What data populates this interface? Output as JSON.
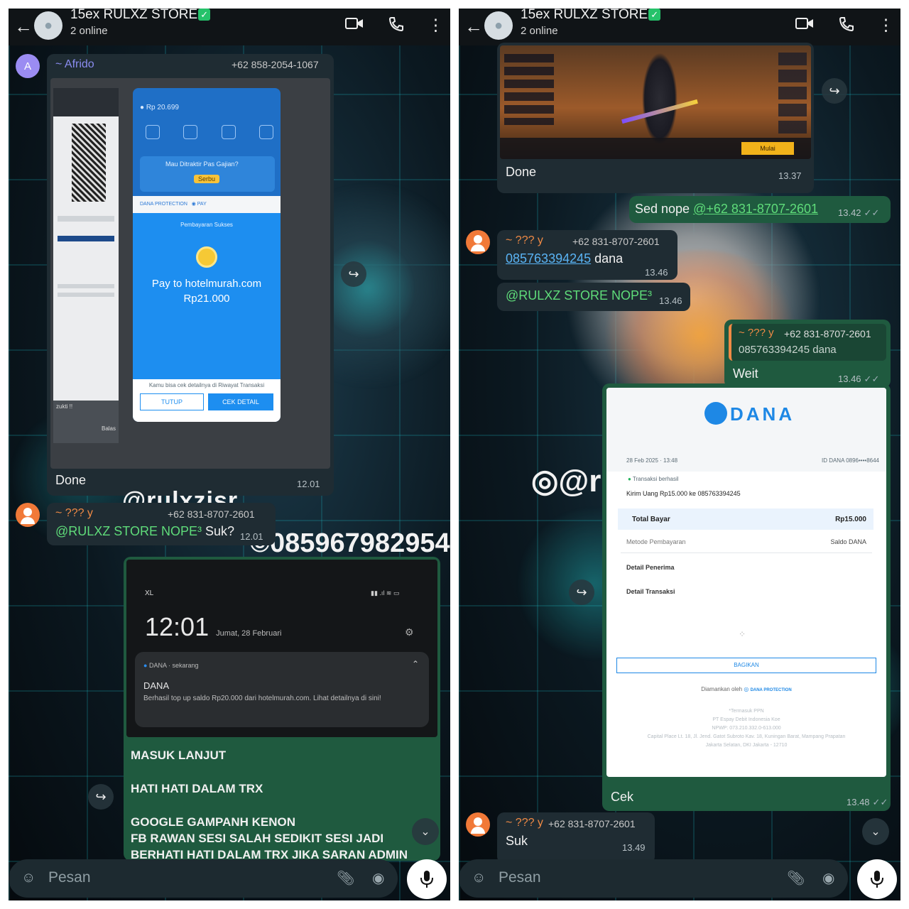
{
  "screen_left": {
    "header": {
      "title": "15ex RULXZ STORE",
      "status": "2 online"
    },
    "msg1": {
      "sender": "~ Afrido",
      "phone": "+62 858-2054-1067",
      "avatar_letter": "A",
      "shot": {
        "balance": "20.699",
        "promo_title": "Mau Ditraktir Pas",
        "promo_sub": "Gajian?",
        "promo_btn": "Serbu",
        "pay_title": "Pembayaran Sukses",
        "pay_to": "Pay to hotelmurah.com",
        "amount": "Rp21.000",
        "note": "Kamu bisa cek detailnya di Riwayat Transaksi",
        "btn_close": "TUTUP",
        "btn_detail": "CEK DETAIL",
        "left_note": "zukti !!",
        "left_back": "Balas"
      },
      "caption": "Done",
      "time": "12.01"
    },
    "msg2": {
      "sender": "~ ??? y",
      "phone": "+62 831-8707-2601",
      "mention": "@RULXZ STORE NOPE³",
      "text": " Suk?",
      "time": "12.01"
    },
    "bg_text": {
      "handle": "@rulxzjsr",
      "number": "085967982954"
    },
    "msg3": {
      "shot": {
        "carrier": "XL",
        "clock": "12:01",
        "date": "Jumat, 28 Februari",
        "app": "DANA · sekarang",
        "notif_title": "DANA",
        "notif_body": "Berhasil top up saldo Rp20.000 dari hotelmurah.com. Lihat detailnya di sini!"
      },
      "lines": [
        "MASUK LANJUT",
        "HATI HATI DALAM TRX",
        "GOOGLE GAMPANH KENON",
        "FB RAWAN SESI SALAH SEDIKIT SESI JADI",
        "BERHATI HATI DALAM TRX JIKA SARAN ADMIN"
      ]
    },
    "input": {
      "placeholder": "Pesan"
    }
  },
  "screen_right": {
    "header": {
      "title": "15ex RULXZ STORE",
      "status": "2 online"
    },
    "msg1": {
      "caption": "Done",
      "time": "13.37",
      "game_btn": "Mulai"
    },
    "msg2": {
      "text": "Sed nope ",
      "mention": "@+62 831-8707-2601",
      "time": "13.42"
    },
    "msg3": {
      "sender": "~ ??? y",
      "phone": "+62 831-8707-2601",
      "number": "085763394245",
      "text": " dana",
      "time": "13.46"
    },
    "msg4": {
      "mention": "@RULXZ STORE NOPE³",
      "time": "13.46"
    },
    "msg5": {
      "quote_sender": "~ ??? y",
      "quote_phone": "+62 831-8707-2601",
      "quote_text": "085763394245 dana",
      "text": "Weit",
      "time": "13.46"
    },
    "bg_text": {
      "handle": "@r"
    },
    "msg6": {
      "receipt": {
        "logo": "DANA",
        "date": "28 Feb 2025 · 13:48",
        "id": "ID DANA 0896••••8644",
        "status": "Transaksi berhasil",
        "desc": "Kirim Uang Rp15.000 ke 085763394245",
        "total_label": "Total Bayar",
        "total_value": "Rp15.000",
        "method_label": "Metode Pembayaran",
        "method_value": "Saldo DANA",
        "recipient": "Detail Penerima",
        "transaction": "Detail Transaksi",
        "share": "BAGIKAN",
        "secured": "Diamankan oleh",
        "protection": "DANA PROTECTION",
        "footer1": "*Termasuk PPN",
        "footer2": "PT Espay Debit Indonesia Koe",
        "footer3": "NPWP: 073.210.332.0-613.000",
        "footer4": "Capital Place Lt. 18, Jl. Jend. Gatot Subroto Kav. 18, Kuningan Barat, Mampang Prapatan",
        "footer5": "Jakarta Selatan, DKI Jakarta - 12710"
      },
      "caption": "Cek",
      "time": "13.48"
    },
    "msg7": {
      "sender": "~ ??? y",
      "phone": "+62 831-8707-2601",
      "text": "Suk",
      "time": "13.49"
    },
    "input": {
      "placeholder": "Pesan"
    }
  },
  "colors": {
    "topbar": "#101417",
    "incoming": "#1f2c33",
    "outgoing": "#1f5a3f",
    "mention": "#5fdc7a",
    "link": "#5ab4f5",
    "sender": "#f08a45",
    "dana_blue": "#1e88e5"
  },
  "icons": [
    "back-arrow-icon",
    "group-avatar-icon",
    "verified-icon",
    "video-call-icon",
    "voice-call-icon",
    "more-icon",
    "forward-icon",
    "scroll-down-icon",
    "emoji-icon",
    "attach-icon",
    "camera-icon",
    "mic-icon"
  ]
}
